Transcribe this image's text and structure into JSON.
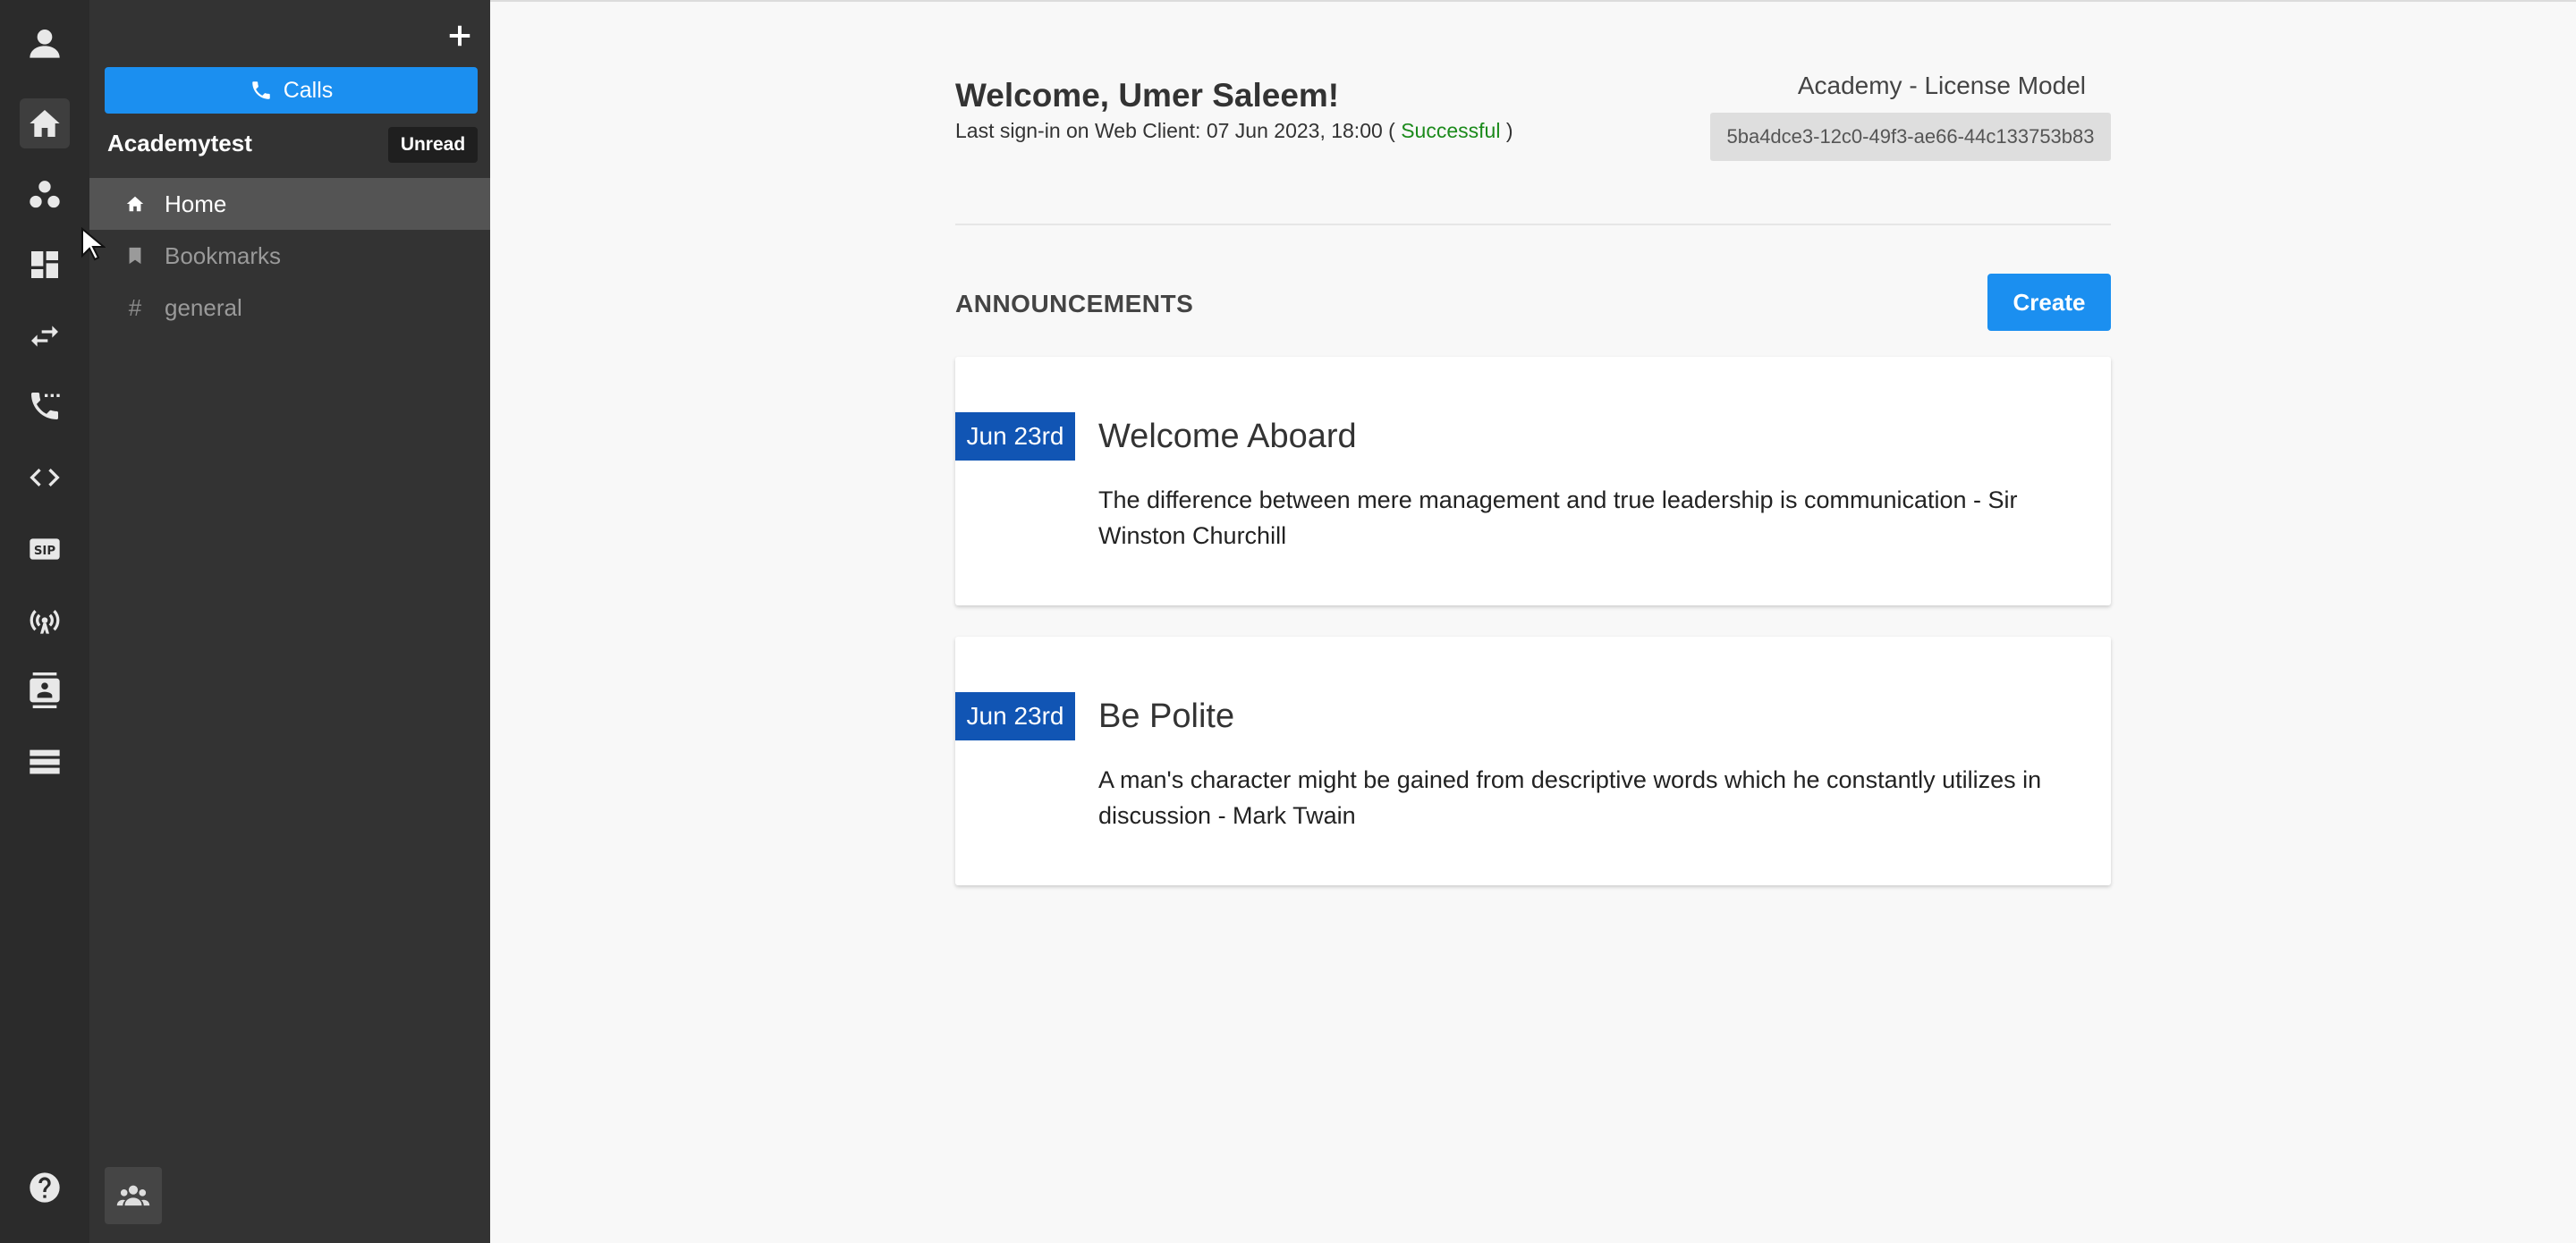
{
  "sidebar": {
    "calls_label": "Calls",
    "workspace_name": "Academytest",
    "unread_label": "Unread",
    "nav": [
      {
        "label": "Home",
        "icon": "home-icon"
      },
      {
        "label": "Bookmarks",
        "icon": "bookmark-icon"
      },
      {
        "label": "general",
        "icon": "hash-icon"
      }
    ],
    "hash_symbol": "#"
  },
  "rail_icons": [
    "user-icon",
    "home-icon",
    "groups-icon",
    "dashboard-icon",
    "transfer-icon",
    "phone-dots-icon",
    "code-icon",
    "sip-icon",
    "broadcast-icon",
    "contact-card-icon",
    "list-icon",
    "help-icon"
  ],
  "main": {
    "welcome": "Welcome, Umer Saleem!",
    "last_signin_prefix": "Last sign-in on Web Client: 07 Jun 2023, 18:00 ( ",
    "last_signin_status": "Successful",
    "last_signin_suffix": " )",
    "license_model": "Academy - License Model",
    "license_id": "5ba4dce3-12c0-49f3-ae66-44c133753b83",
    "announcements_title": "ANNOUNCEMENTS",
    "create_label": "Create",
    "announcements": [
      {
        "date": "Jun 23rd",
        "title": "Welcome Aboard",
        "body": "The difference between mere management and true leadership is communication - Sir Winston Churchill"
      },
      {
        "date": "Jun 23rd",
        "title": "Be Polite",
        "body": "A man's character might be gained from descriptive words which he constantly utilizes in discussion - Mark Twain"
      }
    ]
  },
  "colors": {
    "accent": "#1b8ff0",
    "date_badge": "#1155b4",
    "success": "#1b8a1b",
    "rail_bg": "#2b2b2b",
    "sidebar_bg": "#333333"
  }
}
